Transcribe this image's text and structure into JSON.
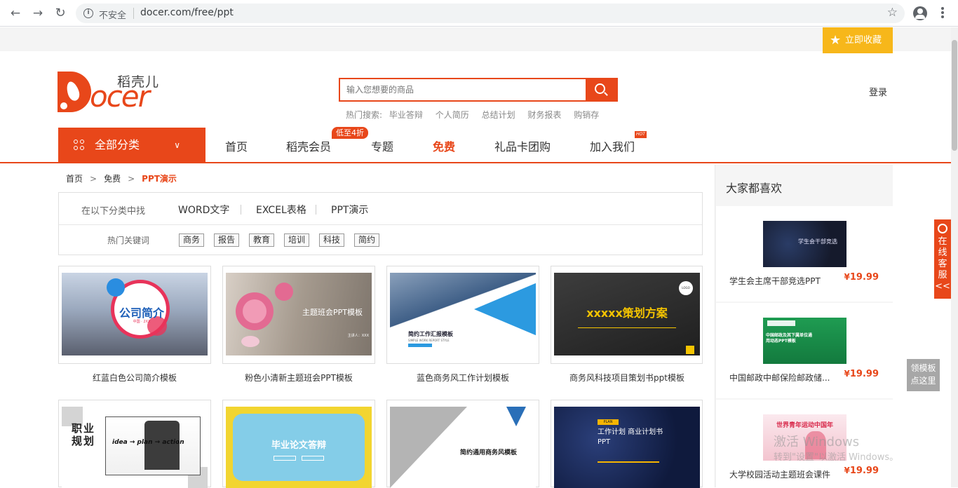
{
  "browser": {
    "insecure_label": "不安全",
    "url": "docer.com/free/ppt"
  },
  "header": {
    "favorite_label": "立即收藏",
    "logo_cn": "稻壳儿",
    "logo_en": "ocer",
    "login": "登录"
  },
  "search": {
    "placeholder": "输入您想要的商品",
    "hot_label": "热门搜索:",
    "hot_terms": [
      "毕业答辩",
      "个人简历",
      "总结计划",
      "财务报表",
      "购销存"
    ]
  },
  "nav": {
    "all_categories": "全部分类",
    "items": [
      "首页",
      "稻壳会员",
      "专题",
      "免费",
      "礼品卡团购",
      "加入我们"
    ],
    "discount_badge": "低至4折",
    "hot_badge": "HOT",
    "active": "免费"
  },
  "breadcrumb": [
    "首页",
    "免费",
    "PPT演示"
  ],
  "filter": {
    "category_label": "在以下分类中找",
    "categories": [
      "WORD文字",
      "EXCEL表格",
      "PPT演示"
    ],
    "keyword_label": "热门关键词",
    "keywords": [
      "商务",
      "报告",
      "教育",
      "培训",
      "科技",
      "简约"
    ]
  },
  "templates": [
    {
      "title": "红蓝白色公司简介模板",
      "thumb_text": "公司简介",
      "thumb_sub": "中国 · 2XX"
    },
    {
      "title": "粉色小清新主题班会PPT模板",
      "thumb_text": "主题班会PPT模板",
      "thumb_sub": "主讲人：XXX"
    },
    {
      "title": "蓝色商务风工作计划模板",
      "thumb_text": "简约工作汇报模板",
      "thumb_sub": "SIMPLE WORK REPORT STYLE"
    },
    {
      "title": "商务风科技项目策划书ppt模板",
      "thumb_text": "xxxxx策划方案",
      "thumb_sub": "LOGO"
    },
    {
      "title": "",
      "thumb_text": "职业规划",
      "thumb_sub": "idea → plan → action"
    },
    {
      "title": "",
      "thumb_text": "毕业论文答辩",
      "thumb_sub": ""
    },
    {
      "title": "",
      "thumb_text": "简约通用商务风模板",
      "thumb_sub": ""
    },
    {
      "title": "",
      "thumb_text": "工作计划 商业计划书PPT",
      "thumb_sub": "PLAN"
    }
  ],
  "sidebar": {
    "heading": "大家都喜欢",
    "items": [
      {
        "name": "学生会主席干部竞选PPT",
        "currency": "¥",
        "price": "19.99",
        "thumb_text": "学生会干部竞选"
      },
      {
        "name": "中国邮政中邮保险邮政储...",
        "currency": "¥",
        "price": "19.99",
        "thumb_text": "中国邮政及其下属单位通用动态PPT模板"
      },
      {
        "name": "大学校园活动主题班会课件",
        "currency": "¥",
        "price": "19.99",
        "thumb_text": "世界青年运动中国年"
      }
    ]
  },
  "floating": {
    "online_service": [
      "在",
      "线",
      "客",
      "服",
      "<<"
    ],
    "get_template": [
      "领模板",
      "点这里"
    ]
  },
  "watermark": {
    "line1": "激活 Windows",
    "line2": "转到\"设置\"以激活 Windows。"
  }
}
